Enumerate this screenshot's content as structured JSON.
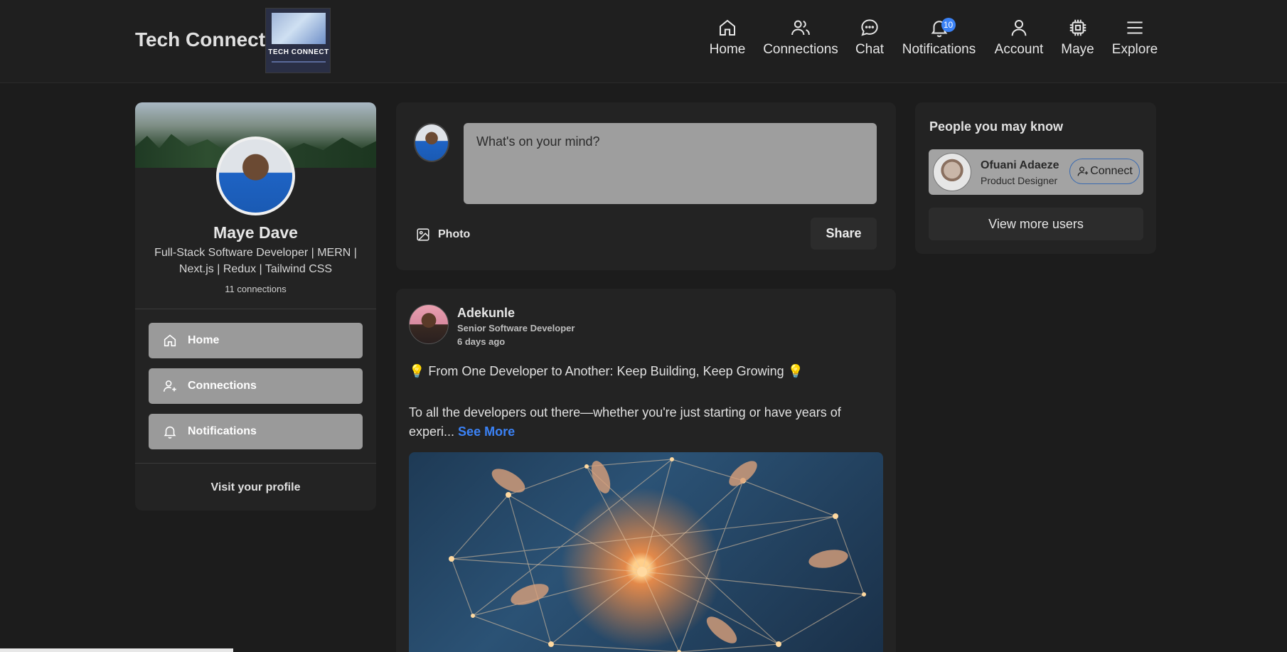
{
  "header": {
    "brand": "Tech Connect",
    "logo_text": "TECH CONNECT",
    "nav": [
      {
        "label": "Home",
        "icon": "home-icon"
      },
      {
        "label": "Connections",
        "icon": "users-icon"
      },
      {
        "label": "Chat",
        "icon": "chat-icon"
      },
      {
        "label": "Notifications",
        "icon": "bell-icon",
        "badge": "10"
      },
      {
        "label": "Account",
        "icon": "user-icon"
      },
      {
        "label": "Maye",
        "icon": "chip-icon"
      },
      {
        "label": "Explore",
        "icon": "menu-icon"
      }
    ]
  },
  "profile": {
    "name": "Maye Dave",
    "bio": "Full-Stack Software Developer | MERN | Next.js | Redux | Tailwind CSS",
    "connections": "11 connections",
    "menu": [
      {
        "label": "Home",
        "icon": "home-icon"
      },
      {
        "label": "Connections",
        "icon": "user-plus-icon"
      },
      {
        "label": "Notifications",
        "icon": "bell-icon"
      }
    ],
    "visit_label": "Visit your profile"
  },
  "composer": {
    "placeholder": "What's on your mind?",
    "photo_label": "Photo",
    "share_label": "Share"
  },
  "post": {
    "author": "Adekunle",
    "title": "Senior Software Developer",
    "time": "6 days ago",
    "headline": "💡 From One Developer to Another: Keep Building, Keep Growing 💡",
    "body": "To all the developers out there—whether you're just starting or have years of experi...",
    "see_more": "See More"
  },
  "suggestions": {
    "title": "People you may know",
    "people": [
      {
        "name": "Ofuani Adaeze",
        "role": "Product Designer",
        "action": "Connect"
      }
    ],
    "view_more": "View more users"
  },
  "colors": {
    "background": "#1c1c1c",
    "card": "#232323",
    "accent": "#3b82f6",
    "button_gray": "#9a9a9a"
  }
}
